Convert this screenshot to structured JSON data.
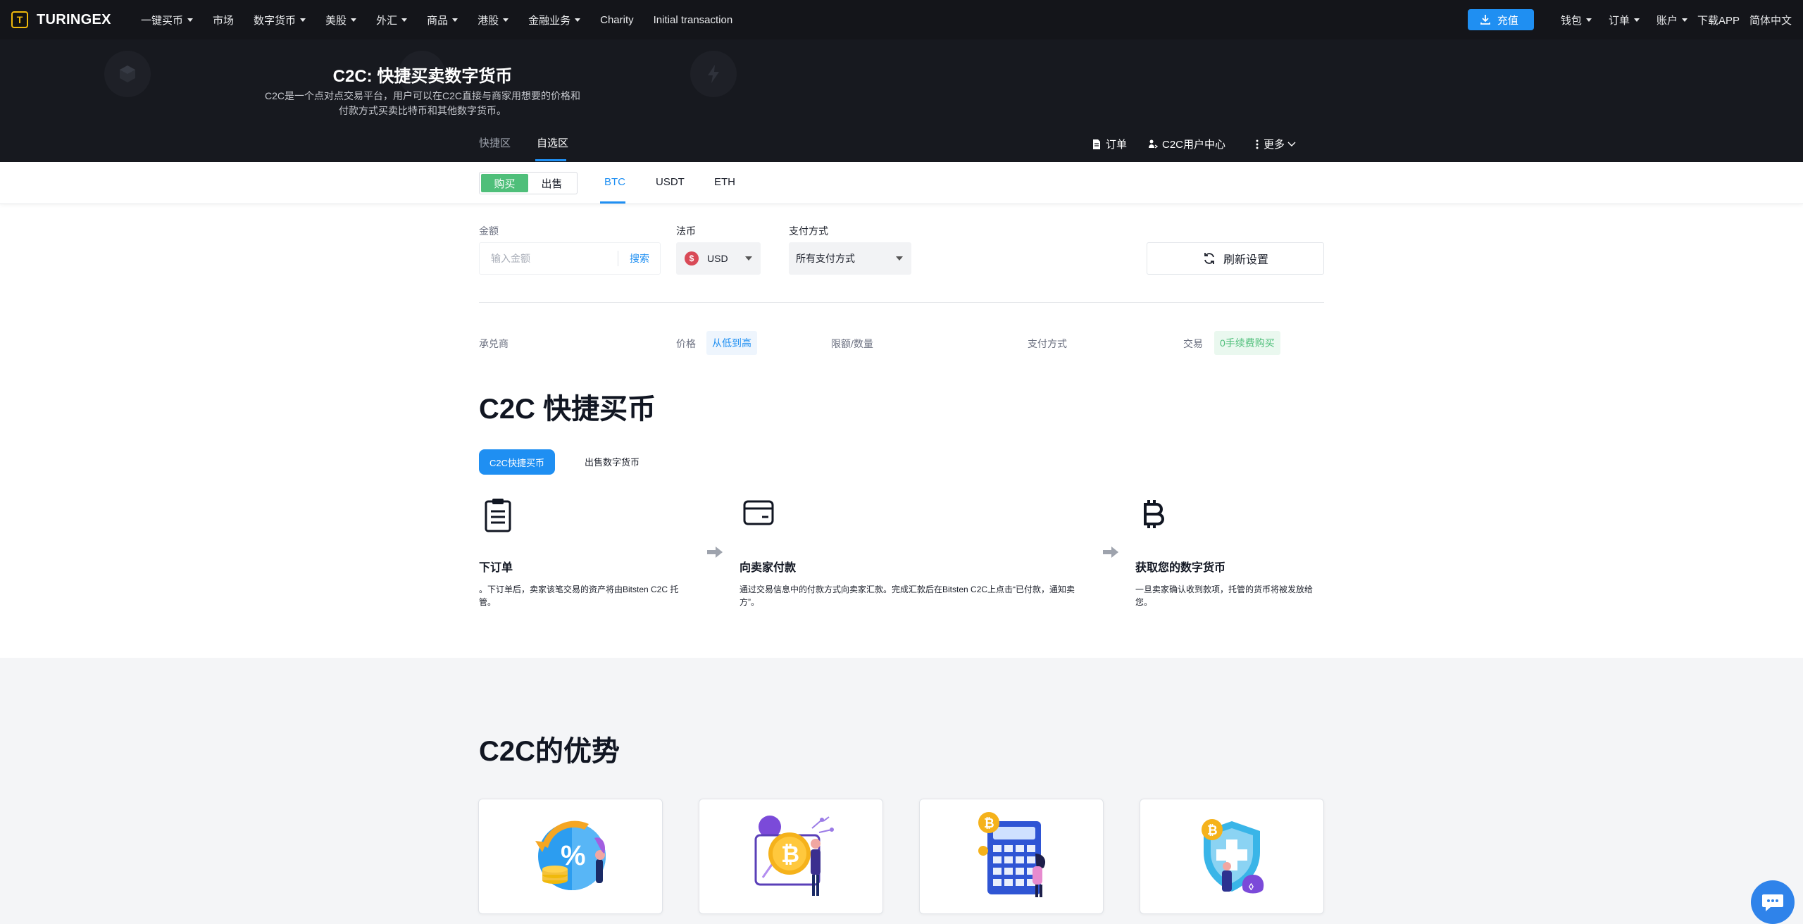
{
  "brand": {
    "name": "TURINGEX",
    "mark": "T"
  },
  "nav": {
    "items": [
      {
        "label": "一键买币",
        "caret": true
      },
      {
        "label": "市场",
        "caret": false
      },
      {
        "label": "数字货币",
        "caret": true
      },
      {
        "label": "美股",
        "caret": true
      },
      {
        "label": "外汇",
        "caret": true
      },
      {
        "label": "商品",
        "caret": true
      },
      {
        "label": "港股",
        "caret": true
      },
      {
        "label": "金融业务",
        "caret": true
      },
      {
        "label": "Charity",
        "caret": false
      },
      {
        "label": "Initial transaction",
        "caret": false
      }
    ],
    "deposit": "充值",
    "right": [
      {
        "label": "钱包",
        "caret": true
      },
      {
        "label": "订单",
        "caret": true
      },
      {
        "label": "账户",
        "caret": true
      },
      {
        "label": "下载APP",
        "caret": false
      },
      {
        "label": "简体中文",
        "caret": false
      }
    ]
  },
  "hero": {
    "title": "C2C: 快捷买卖数字货币",
    "desc_line1": "C2C是一个点对点交易平台，用户可以在C2C直接与商家用想要的价格和",
    "desc_line2": "付款方式买卖比特币和其他数字货币。",
    "tabs": [
      "快捷区",
      "自选区"
    ],
    "active_tab": "自选区",
    "orders_link": "订单",
    "user_center_link": "C2C用户中心",
    "more_link": "更多"
  },
  "toolbar": {
    "buy": "购买",
    "sell": "出售",
    "coins": [
      "BTC",
      "USDT",
      "ETH"
    ],
    "active_coin": "BTC"
  },
  "filters": {
    "amount_label": "金额",
    "amount_placeholder": "输入金额",
    "search": "搜索",
    "fiat_label": "法币",
    "fiat_value": "USD",
    "fiat_symbol": "$",
    "payment_label": "支付方式",
    "payment_value": "所有支付方式",
    "refresh": "刷新设置"
  },
  "table_header": {
    "merchant": "承兑商",
    "price": "价格",
    "sort": "从低到高",
    "limit": "限额/数量",
    "payment": "支付方式",
    "trade": "交易",
    "zero_fee": "0手续费购买"
  },
  "quick_buy": {
    "title": "C2C 快捷买币",
    "tab_active": "C2C快捷买币",
    "tab_other": "出售数字货币",
    "steps": [
      {
        "icon": "clipboard-icon",
        "title": "下订单",
        "desc1": "。下订单后，卖家该笔交易的资产将由Bitsten C2C 托",
        "desc2": "管。"
      },
      {
        "icon": "card-icon",
        "title": "向卖家付款",
        "desc1": "通过交易信息中的付款方式向卖家汇款。完成汇款后在Bitsten C2C上点击“已付款，通知卖",
        "desc2": "方”。"
      },
      {
        "icon": "bitcoin-icon",
        "title": "获取您的数字货币",
        "desc1": "一旦卖家确认收到款项，托管的货币将被发放给",
        "desc2": "您。"
      }
    ]
  },
  "advantages": {
    "title": "C2C的优势",
    "cards": [
      "discount-coins-illustration",
      "bitcoin-monitor-illustration",
      "calculator-illustration",
      "shield-bitcoin-illustration"
    ]
  },
  "colors": {
    "accent": "#1f8ff2",
    "buy": "#4fbf7a",
    "nav_bg": "#14151a",
    "hero_bg": "#17191f"
  }
}
